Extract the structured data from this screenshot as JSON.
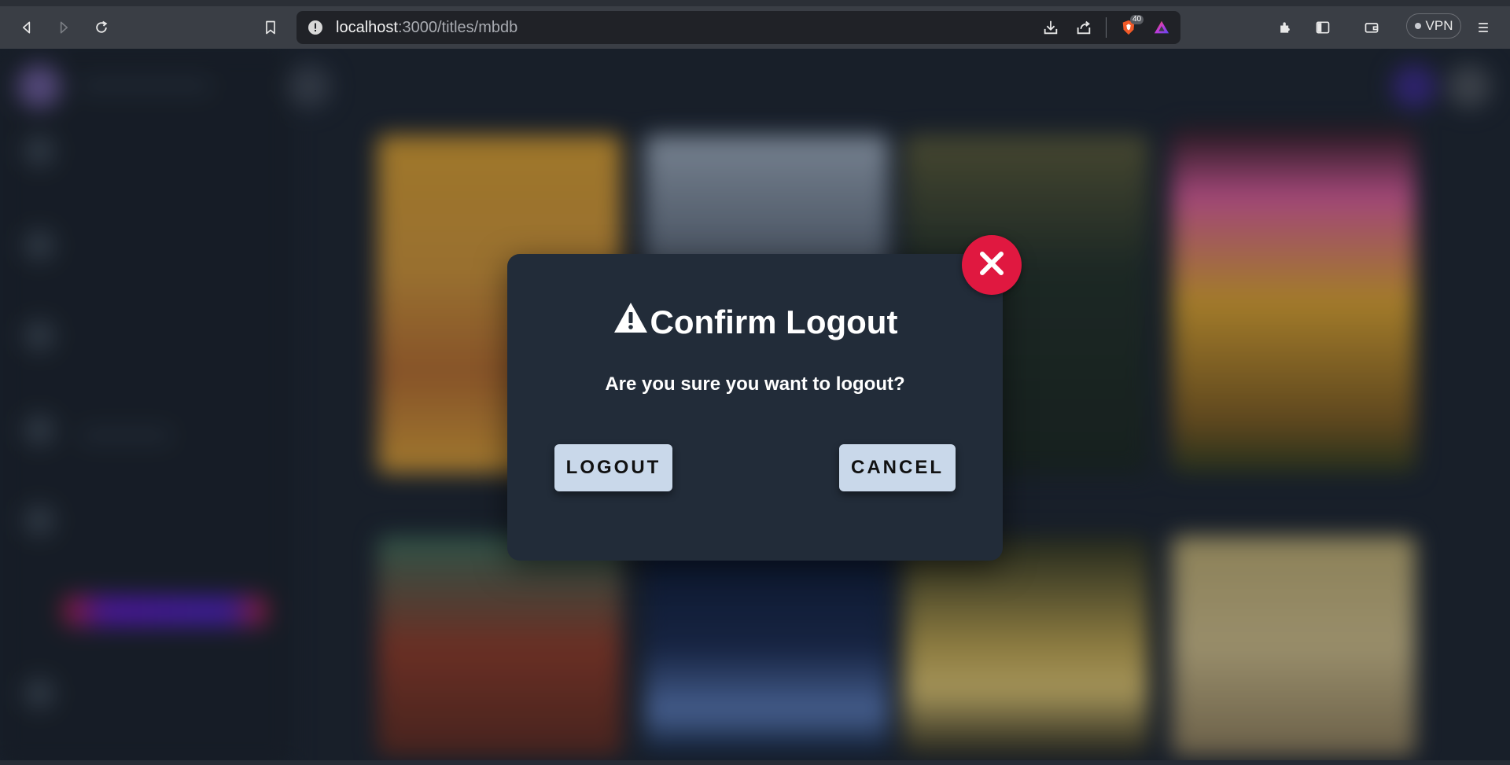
{
  "browser": {
    "url_host": "localhost",
    "url_path": ":3000/titles/mbdb",
    "brave_badge_count": "40",
    "vpn_label": "VPN",
    "icons": {
      "back": "back-arrow-icon",
      "forward": "forward-arrow-icon",
      "reload": "reload-icon",
      "bookmark": "bookmark-icon",
      "site_info": "site-info-icon",
      "download": "download-icon",
      "share": "share-icon",
      "brave_shields": "brave-shields-icon",
      "brave_rewards": "brave-rewards-icon",
      "extensions": "extensions-icon",
      "sidebar": "sidebar-toggle-icon",
      "wallet": "wallet-icon",
      "menu": "menu-icon"
    }
  },
  "modal": {
    "title": "Confirm Logout",
    "message": "Are you sure you want to logout?",
    "logout_label": "LOGOUT",
    "cancel_label": "CANCEL",
    "icons": {
      "warning": "warning-icon",
      "close": "close-icon"
    }
  },
  "colors": {
    "close_button": "#e01840",
    "modal_bg": "#222c39",
    "button_bg": "#c9d8ea"
  }
}
